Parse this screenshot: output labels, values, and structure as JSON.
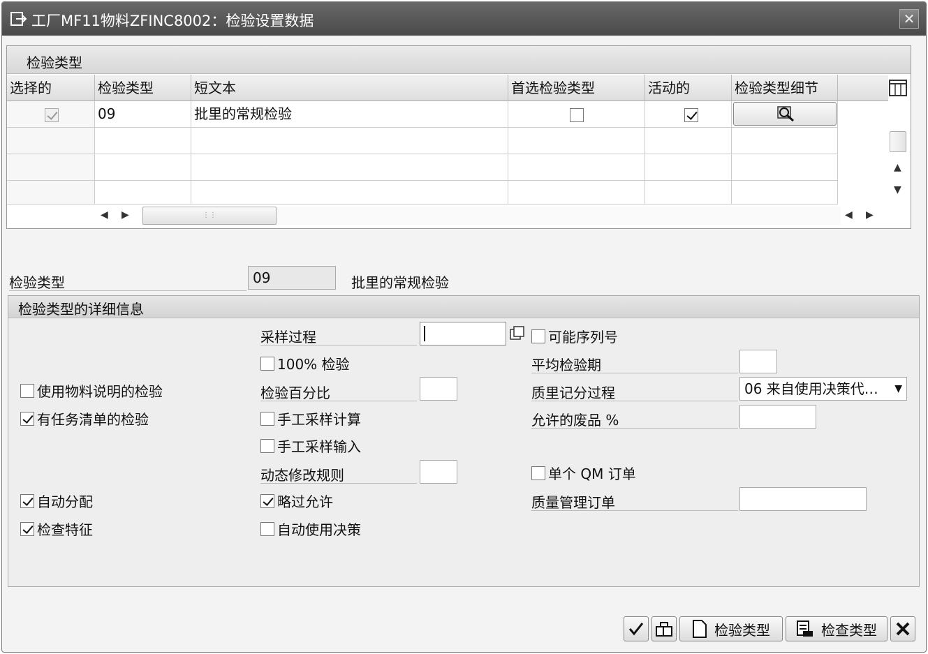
{
  "window": {
    "title": "工厂MF11物料ZFINC8002：检验设置数据",
    "close_glyph": "✕"
  },
  "table": {
    "section_title": "检验类型",
    "columns": [
      "选择的",
      "检验类型",
      "短文本",
      "首选检验类型",
      "活动的",
      "检验类型细节"
    ],
    "rows": [
      {
        "selected": true,
        "type": "09",
        "text": "批里的常规检验",
        "preferred": false,
        "active": true
      }
    ]
  },
  "summary": {
    "label": "检验类型",
    "value": "09",
    "description": "批里的常规检验"
  },
  "details": {
    "section_title": "检验类型的详细信息",
    "col1": {
      "use_material_spec": {
        "label": "使用物料说明的检验",
        "checked": false
      },
      "task_list": {
        "label": "有任务清单的检验",
        "checked": true
      },
      "auto_assign": {
        "label": "自动分配",
        "checked": true
      },
      "check_char": {
        "label": "检查特征",
        "checked": true
      }
    },
    "col2": {
      "sampling_proc_label": "采样过程",
      "sampling_proc_value": "",
      "hundred_pct": {
        "label": "100% 检验",
        "checked": false
      },
      "insp_percent_label": "检验百分比",
      "manual_sample_calc": {
        "label": "手工采样计算",
        "checked": false
      },
      "manual_sample_entry": {
        "label": "手工采样输入",
        "checked": false
      },
      "dyn_mod_rule_label": "动态修改规则",
      "skip_allowed": {
        "label": "略过允许",
        "checked": true
      },
      "auto_ud": {
        "label": "自动使用决策",
        "checked": false
      }
    },
    "col3": {
      "serial_possible": {
        "label": "可能序列号",
        "checked": false
      },
      "avg_insp_period_label": "平均检验期",
      "quality_score_label": "质里记分过程",
      "quality_score_value": "06 来自使用决策代…",
      "allowed_scrap_label": "允许的废品 %",
      "single_qm_order": {
        "label": "单个 QM 订单",
        "checked": false
      },
      "qm_order_label": "质量管理订单"
    }
  },
  "buttons": {
    "ok": {
      "icon": "checkmark-icon"
    },
    "copy": {
      "icon": "copy-model-icon"
    },
    "new_type": {
      "icon": "new-document-icon",
      "label": "检验类型"
    },
    "check_type": {
      "icon": "check-list-icon",
      "label": "检查类型"
    },
    "cancel": {
      "icon": "cancel-x-icon"
    }
  }
}
